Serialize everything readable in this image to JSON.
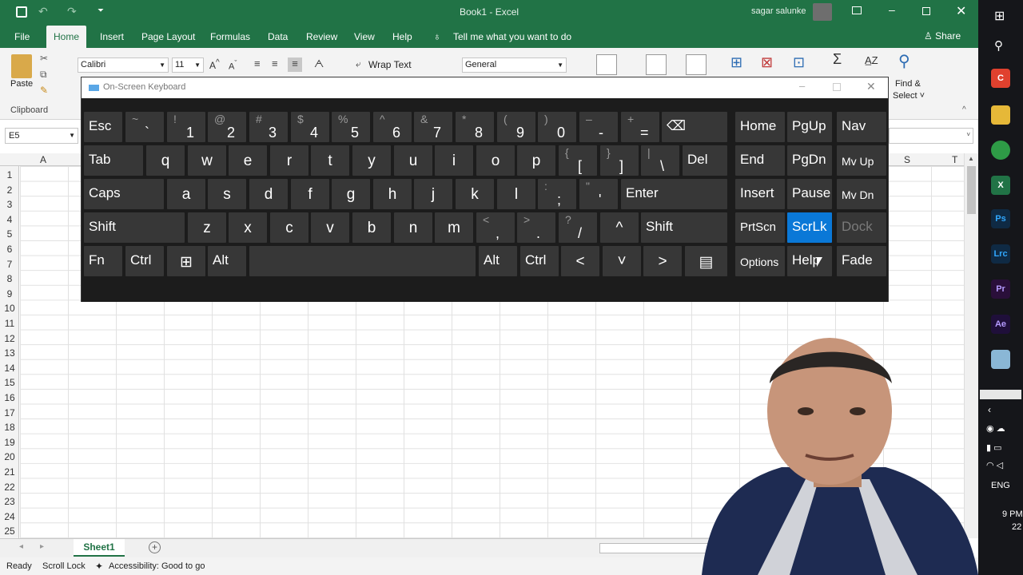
{
  "titlebar": {
    "title": "Book1  -  Excel",
    "user": "sagar salunke"
  },
  "tabs": [
    {
      "label": "File"
    },
    {
      "label": "Home"
    },
    {
      "label": "Insert"
    },
    {
      "label": "Page Layout"
    },
    {
      "label": "Formulas"
    },
    {
      "label": "Data"
    },
    {
      "label": "Review"
    },
    {
      "label": "View"
    },
    {
      "label": "Help"
    }
  ],
  "tell_me": "Tell me what you want to do",
  "share": "Share",
  "ribbon": {
    "paste": "Paste",
    "clipboard": "Clipboard",
    "font_name": "Calibri",
    "font_size": "11",
    "wrap_text": "Wrap Text",
    "number_format": "General",
    "find_select_1": "Find &",
    "find_select_2": "Select ˅"
  },
  "name_box": "E5",
  "columns": {
    "first": "A",
    "s": "S",
    "t": "T"
  },
  "rows": [
    "1",
    "2",
    "3",
    "4",
    "5",
    "6",
    "7",
    "8",
    "9",
    "10",
    "11",
    "12",
    "13",
    "14",
    "15",
    "16",
    "17",
    "18",
    "19",
    "20",
    "21",
    "22",
    "23",
    "24",
    "25"
  ],
  "sheet_tab": "Sheet1",
  "status": {
    "ready": "Ready",
    "scroll_lock": "Scroll Lock",
    "accessibility": "Accessibility: Good to go"
  },
  "osk": {
    "title": "On-Screen Keyboard",
    "keys": {
      "esc": "Esc",
      "bksp": "⌫",
      "home": "Home",
      "pgup": "PgUp",
      "nav": "Nav",
      "tab": "Tab",
      "del": "Del",
      "end": "End",
      "pgdn": "PgDn",
      "mvup": "Mv Up",
      "caps": "Caps",
      "enter": "Enter",
      "insert": "Insert",
      "pause": "Pause",
      "mvdn": "Mv Dn",
      "shift": "Shift",
      "prtscn": "PrtScn",
      "scrlk": "ScrLk",
      "dock": "Dock",
      "fn": "Fn",
      "ctrl": "Ctrl",
      "alt": "Alt",
      "options": "Options",
      "help": "Help",
      "fade": "Fade",
      "up": "^",
      "down": "˅",
      "left": "<",
      "right": ">",
      "menu": "▤",
      "win": "⊞",
      "n1s": "!",
      "n1": "1",
      "n2s": "@",
      "n2": "2",
      "n3s": "#",
      "n3": "3",
      "n4s": "$",
      "n4": "4",
      "n5s": "%",
      "n5": "5",
      "n6s": "^",
      "n6": "6",
      "n7s": "&",
      "n7": "7",
      "n8s": "*",
      "n8": "8",
      "n9s": "(",
      "n9": "9",
      "n0s": ")",
      "n0": "0",
      "mins": "–",
      "min": "-",
      "eqs": "+",
      "eq": "=",
      "tils": "~",
      "til": "`",
      "q": "q",
      "w": "w",
      "e": "e",
      "r": "r",
      "t": "t",
      "y": "y",
      "u": "u",
      "i": "i",
      "o": "o",
      "p": "p",
      "lbs": "{",
      "lb": "[",
      "rbs": "}",
      "rb": "]",
      "bss": "|",
      "bs": "\\",
      "a": "a",
      "s": "s",
      "d": "d",
      "f": "f",
      "g": "g",
      "h": "h",
      "j": "j",
      "k": "k",
      "l": "l",
      "scs": ":",
      "sc": ";",
      "qts": "\"",
      "qt": "'",
      "z": "z",
      "x": "x",
      "c": "c",
      "v": "v",
      "b": "b",
      "n": "n",
      "m": "m",
      "cms": "<",
      "cm": ",",
      "dts": ">",
      "dt": ".",
      "sls": "?",
      "sl": "/"
    }
  },
  "taskbar": {
    "lang": "ENG",
    "time": "9 PM",
    "date": "22"
  },
  "colors": {
    "excel_green": "#217346",
    "key": "#373737",
    "key_active": "#0a78d7",
    "osk_bg": "#1c1c1c"
  }
}
